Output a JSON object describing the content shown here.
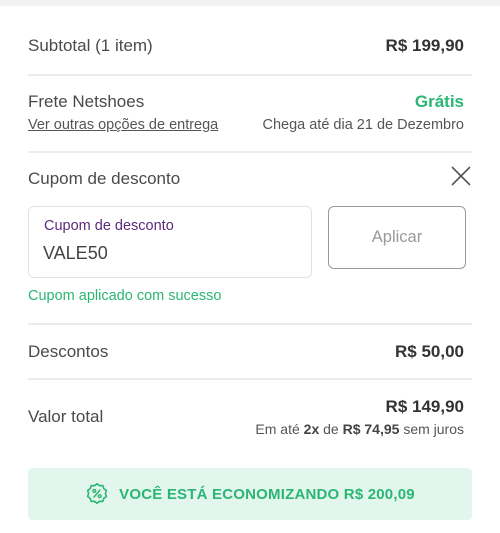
{
  "summary": {
    "subtotal_label": "Subtotal (1 item)",
    "subtotal_value": "R$ 199,90"
  },
  "shipping": {
    "label": "Frete Netshoes",
    "options_link": "Ver outras opções de entrega",
    "price": "Grátis",
    "eta": "Chega até dia 21 de Dezembro"
  },
  "coupon": {
    "section_title": "Cupom de desconto",
    "field_label": "Cupom de desconto",
    "field_value": "VALE50",
    "apply_label": "Aplicar",
    "success_message": "Cupom aplicado com sucesso"
  },
  "discounts": {
    "label": "Descontos",
    "value": "R$ 50,00"
  },
  "total": {
    "label": "Valor total",
    "value": "R$ 149,90",
    "installment_prefix": "Em até",
    "installment_count": "2x",
    "installment_mid": "de",
    "installment_amount": "R$ 74,95",
    "installment_suffix": "sem juros"
  },
  "savings_banner": {
    "text": "VOCÊ ESTÁ ECONOMIZANDO R$ 200,09",
    "icon": "percent-badge-icon"
  },
  "colors": {
    "accent_green": "#2ab673",
    "label_purple": "#5b2b7a",
    "banner_bg": "#e3f6ee"
  }
}
